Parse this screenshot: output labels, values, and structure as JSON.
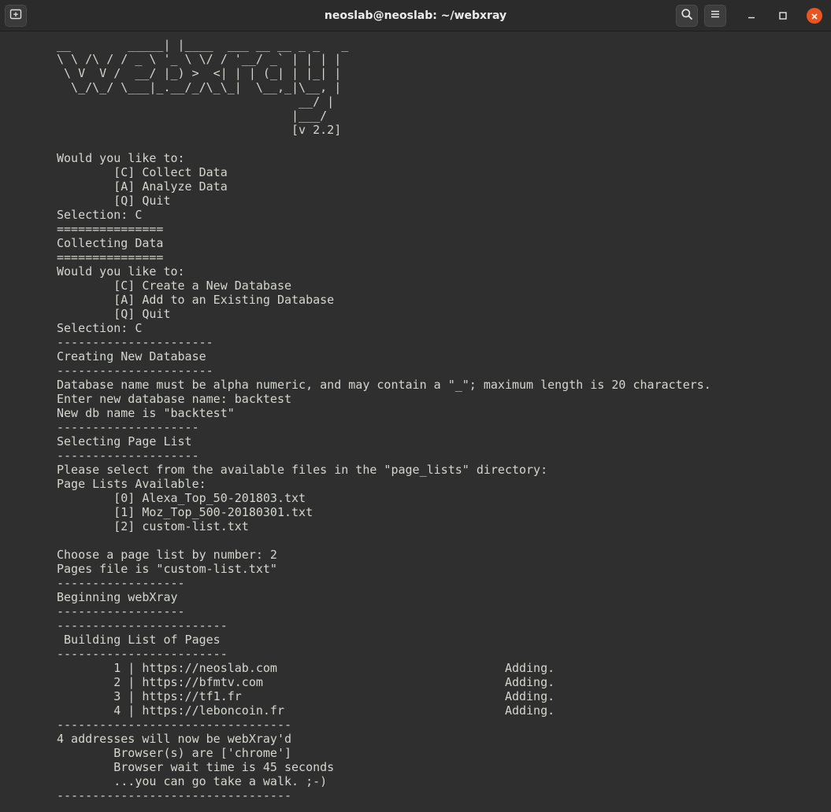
{
  "window": {
    "title": "neoslab@neoslab: ~/webxray",
    "icons": {
      "new_tab": "new-tab-icon",
      "search": "search-icon",
      "menu": "hamburger-menu-icon",
      "minimize": "minimize-icon",
      "maximize": "maximize-icon",
      "close": "close-icon"
    },
    "accent_close_color": "#e95420"
  },
  "terminal": {
    "background": "#2f2f2f",
    "foreground": "#d3d7cf",
    "output": "__        _____| |____  ___ __ __ _ _   _\n\\ \\ /\\ / / _ \\ '_ \\ \\/ / '__/ _` | | | |\n \\ V  V /  __/ |_) >  <| | | (_| | |_| |\n  \\_/\\_/ \\___|_.__/_/\\_\\_|  \\__,_|\\__, |\n                                  __/ |\n                                 |___/\n                                 [v 2.2]\n\nWould you like to:\n        [C] Collect Data\n        [A] Analyze Data\n        [Q] Quit\nSelection: C\n===============\nCollecting Data\n===============\nWould you like to:\n        [C] Create a New Database\n        [A] Add to an Existing Database\n        [Q] Quit\nSelection: C\n----------------------\nCreating New Database\n----------------------\nDatabase name must be alpha numeric, and may contain a \"_\"; maximum length is 20 characters.\nEnter new database name: backtest\nNew db name is \"backtest\"\n--------------------\nSelecting Page List\n--------------------\nPlease select from the available files in the \"page_lists\" directory:\nPage Lists Available:\n        [0] Alexa_Top_50-201803.txt\n        [1] Moz_Top_500-20180301.txt\n        [2] custom-list.txt\n\nChoose a page list by number: 2\nPages file is \"custom-list.txt\"\n------------------\nBeginning webXray\n------------------\n------------------------\n Building List of Pages\n------------------------\n        1 | https://neoslab.com                                Adding.\n        2 | https://bfmtv.com                                  Adding.\n        3 | https://tf1.fr                                     Adding.\n        4 | https://leboncoin.fr                               Adding.\n---------------------------------\n4 addresses will now be webXray'd\n        Browser(s) are ['chrome']\n        Browser wait time is 45 seconds\n        ...you can go take a walk. ;-)\n---------------------------------"
  }
}
